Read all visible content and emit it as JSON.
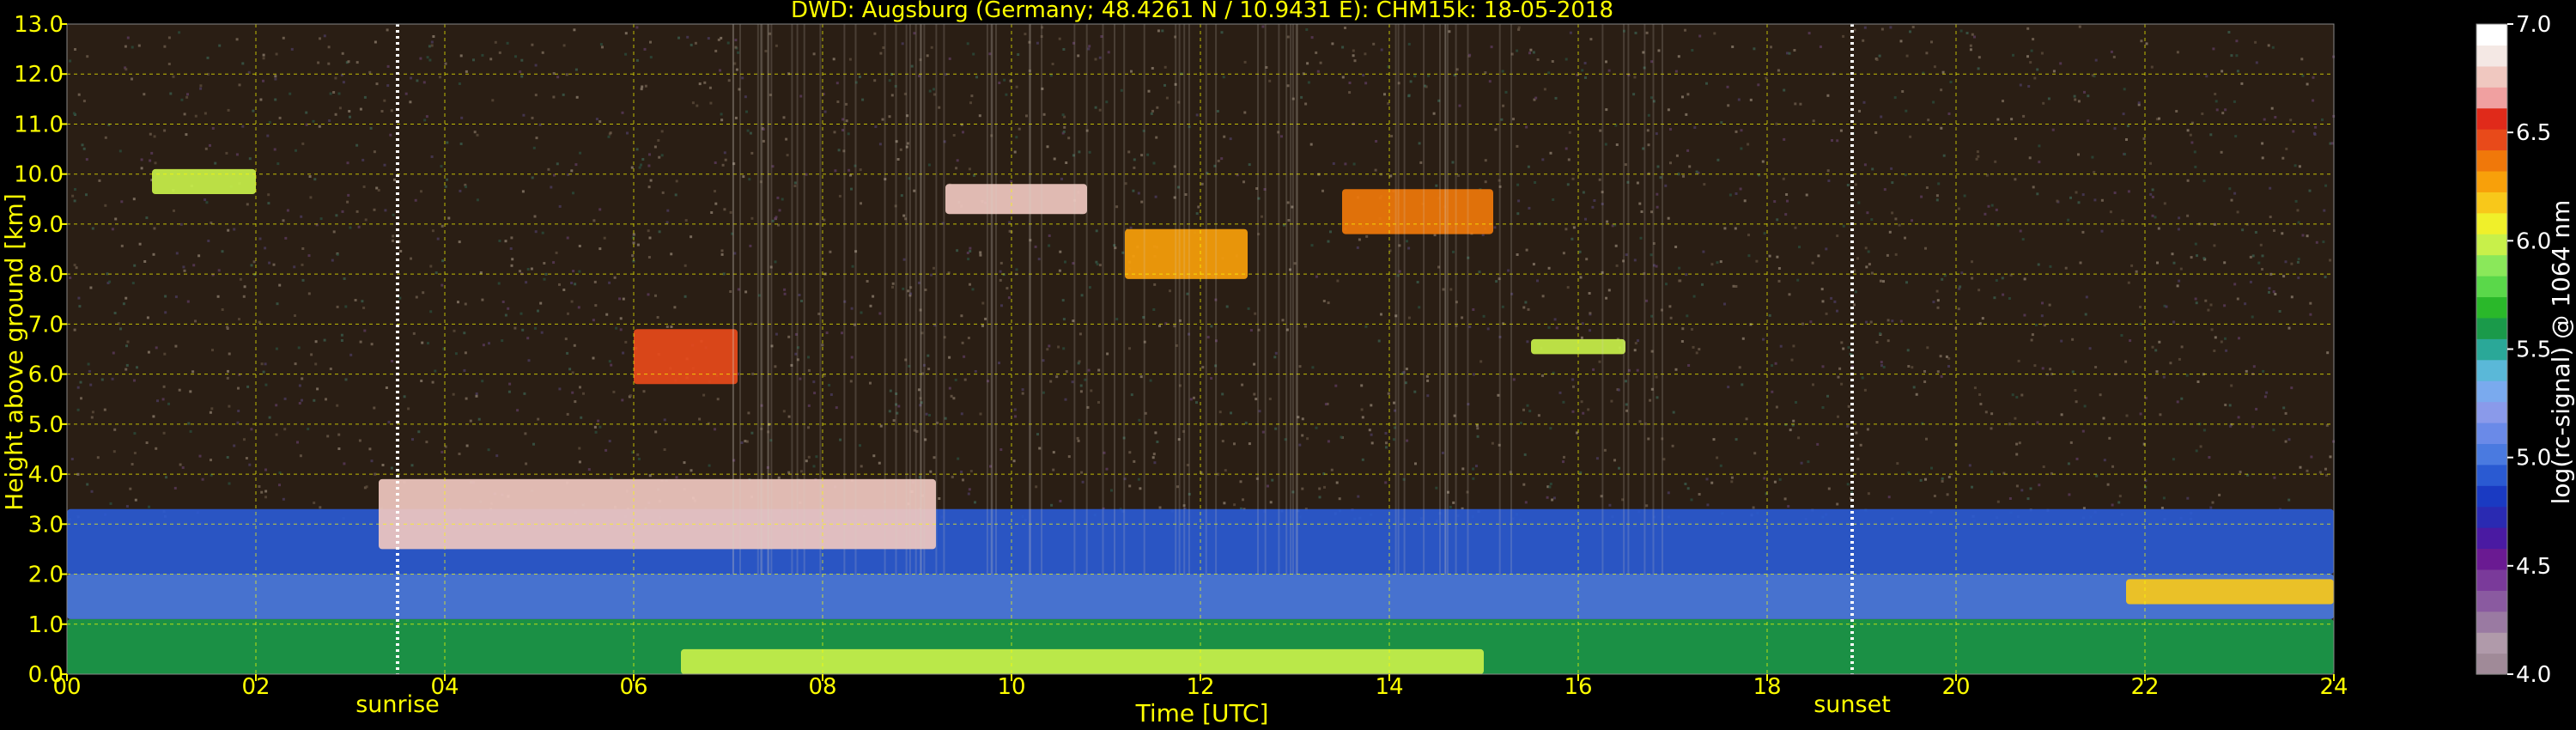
{
  "chart_data": {
    "type": "heatmap",
    "title": "DWD: Augsburg (Germany; 48.4261 N / 10.9431 E):    CHM15k: 18-05-2018",
    "xlabel": "Time [UTC]",
    "ylabel": "Height above ground [km]",
    "xlim": [
      0,
      24
    ],
    "ylim": [
      0,
      13
    ],
    "x_ticks": [
      0,
      2,
      4,
      6,
      8,
      10,
      12,
      14,
      16,
      18,
      20,
      22,
      24
    ],
    "x_tick_labels": [
      "00",
      "02",
      "04",
      "06",
      "08",
      "10",
      "12",
      "14",
      "16",
      "18",
      "20",
      "22",
      "24"
    ],
    "y_ticks": [
      0,
      1,
      2,
      3,
      4,
      5,
      6,
      7,
      8,
      9,
      10,
      11,
      12,
      13
    ],
    "y_tick_labels": [
      "0.0",
      "1.0",
      "2.0",
      "3.0",
      "4.0",
      "5.0",
      "6.0",
      "7.0",
      "8.0",
      "9.0",
      "10.0",
      "11.0",
      "12.0",
      "13.0"
    ],
    "grid": true,
    "markers": [
      {
        "label": "sunrise",
        "x": 3.5
      },
      {
        "label": "sunset",
        "x": 18.9
      }
    ],
    "colorbar": {
      "label": "log(rc-signal) @ 1064 nm",
      "range": [
        4.0,
        7.0
      ],
      "ticks": [
        4.0,
        4.5,
        5.0,
        5.5,
        6.0,
        6.5,
        7.0
      ],
      "tick_labels": [
        "4.0",
        "4.5",
        "5.0",
        "5.5",
        "6.0",
        "6.5",
        "7.0"
      ],
      "colors": [
        "#a08a98",
        "#b09aaa",
        "#9a7aa2",
        "#8a5aa0",
        "#7a3a9a",
        "#6a1a92",
        "#4a1aa2",
        "#2a2ab2",
        "#1a3ac2",
        "#2a5ad2",
        "#4a7ae0",
        "#6a8ae8",
        "#8a9aea",
        "#7aaaee",
        "#5ab8d8",
        "#2aa898",
        "#1a9a4a",
        "#2ab82a",
        "#5ad84a",
        "#8ae85a",
        "#c8f04a",
        "#f0f02a",
        "#f8c81a",
        "#f8a00a",
        "#f0780a",
        "#e84a1a",
        "#e02a1a",
        "#f0a0a0",
        "#f0c8c0",
        "#f4e8e4",
        "#ffffff"
      ]
    },
    "background_color": "#000000",
    "text_color": "#ffff00",
    "layers": [
      {
        "name": "boundary-layer",
        "x": [
          0,
          24
        ],
        "y": [
          0,
          1.1
        ],
        "level": 5.6
      },
      {
        "name": "near-ground-peak",
        "x": [
          6.5,
          15
        ],
        "y": [
          0,
          0.5
        ],
        "level": 6.0
      },
      {
        "name": "residual-layer",
        "x": [
          0,
          24
        ],
        "y": [
          1.1,
          2.0
        ],
        "level": 5.0
      },
      {
        "name": "lofted-aerosol",
        "x": [
          0,
          24
        ],
        "y": [
          2.0,
          3.3
        ],
        "level": 4.9
      },
      {
        "name": "low-cloud",
        "x": [
          3.3,
          9.2
        ],
        "y": [
          2.5,
          3.9
        ],
        "level": 6.8
      },
      {
        "name": "cloud",
        "x": [
          9.3,
          10.8
        ],
        "y": [
          9.2,
          9.8
        ],
        "level": 6.8
      },
      {
        "name": "cirrus",
        "x": [
          0.9,
          2.0
        ],
        "y": [
          9.6,
          10.1
        ],
        "level": 6.0
      },
      {
        "name": "cloud",
        "x": [
          6.0,
          7.1
        ],
        "y": [
          5.8,
          6.9
        ],
        "level": 6.5
      },
      {
        "name": "cloud",
        "x": [
          11.2,
          12.5
        ],
        "y": [
          7.9,
          8.9
        ],
        "level": 6.3
      },
      {
        "name": "cloud",
        "x": [
          13.5,
          15.1
        ],
        "y": [
          8.8,
          9.7
        ],
        "level": 6.4
      },
      {
        "name": "cloud",
        "x": [
          15.5,
          16.5
        ],
        "y": [
          6.4,
          6.7
        ],
        "level": 6.0
      },
      {
        "name": "evening-cloud",
        "x": [
          21.8,
          24
        ],
        "y": [
          1.4,
          1.9
        ],
        "level": 6.2
      }
    ]
  }
}
